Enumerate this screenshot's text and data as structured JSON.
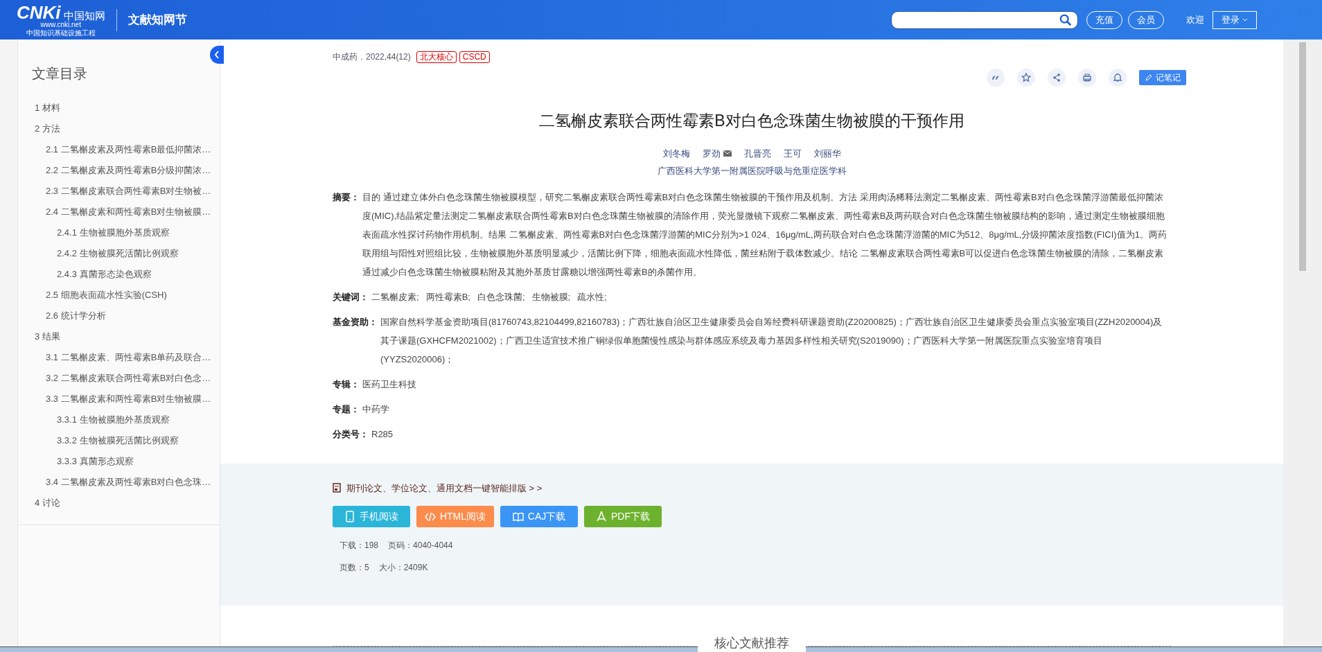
{
  "header": {
    "logo_letters": "CNKi",
    "logo_cn": "中国知网",
    "logo_url": "www.cnki.net",
    "logo_slogan": "中国知识基础设施工程",
    "section_title": "文献知网节",
    "buttons": [
      "充值",
      "会员"
    ],
    "welcome": "欢迎",
    "login": "登录"
  },
  "sidebar": {
    "title": "文章目录",
    "items": [
      {
        "label": "1 材料"
      },
      {
        "label": "2 方法",
        "children": [
          {
            "label": "2.1 二氢槲皮素及两性霉素B最低抑菌浓…"
          },
          {
            "label": "2.2 二氢槲皮素及两性霉素B分级抑菌浓…"
          },
          {
            "label": "2.3 二氢槲皮素联合两性霉素B对生物被…"
          },
          {
            "label": "2.4 二氢槲皮素和两性霉素B对生物被膜…",
            "children": [
              {
                "label": "2.4.1 生物被膜胞外基质观察"
              },
              {
                "label": "2.4.2 生物被膜死活菌比例观察"
              },
              {
                "label": "2.4.3 真菌形态染色观察"
              }
            ]
          },
          {
            "label": "2.5 细胞表面疏水性实验(CSH)"
          },
          {
            "label": "2.6 统计学分析"
          }
        ]
      },
      {
        "label": "3 结果",
        "children": [
          {
            "label": "3.1 二氢槲皮素、两性霉素B单药及联合…"
          },
          {
            "label": "3.2 二氢槲皮素联合两性霉素B对白色念…"
          },
          {
            "label": "3.3 二氢槲皮素和两性霉素B对生物被膜…",
            "children": [
              {
                "label": "3.3.1 生物被膜胞外基质观察"
              },
              {
                "label": "3.3.2 生物被膜死活菌比例观察"
              },
              {
                "label": "3.3.3 真菌形态观察"
              }
            ]
          },
          {
            "label": "3.4 二氢槲皮素及两性霉素B对白色念珠…"
          }
        ]
      },
      {
        "label": "4 讨论"
      }
    ]
  },
  "article": {
    "source": "中成药．2022,44(12)",
    "tags": [
      "北大核心",
      "CSCD"
    ],
    "note_button": "记笔记",
    "title": "二氢槲皮素联合两性霉素B对白色念珠菌生物被膜的干预作用",
    "authors": [
      {
        "name": "刘冬梅",
        "email": false
      },
      {
        "name": "罗劲",
        "email": true
      },
      {
        "name": "孔晋亮",
        "email": false
      },
      {
        "name": "王可",
        "email": false
      },
      {
        "name": "刘丽华",
        "email": false
      }
    ],
    "affiliation": "广西医科大学第一附属医院呼吸与危重症医学科",
    "fields": [
      {
        "kind": "text",
        "label": "摘要：",
        "value": "目的 通过建立体外白色念珠菌生物被膜模型，研究二氢槲皮素联合两性霉素B对白色念珠菌生物被膜的干预作用及机制。方法 采用肉汤稀释法测定二氢槲皮素、两性霉素B对白色念珠菌浮游菌最低抑菌浓度(MIC),结晶紫定量法测定二氢槲皮素联合两性霉素B对白色念珠菌生物被膜的清除作用，荧光显微镜下观察二氢槲皮素、两性霉素B及两药联合对白色念珠菌生物被膜结构的影响，通过测定生物被膜细胞表面疏水性探讨药物作用机制。结果 二氢槲皮素、两性霉素B对白色念珠菌浮游菌的MIC分别为>1 024、16μg/mL,两药联合对白色念珠菌浮游菌的MIC为512、8μg/mL,分级抑菌浓度指数(FICI)值为1。两药联用组与阳性对照组比较，生物被膜胞外基质明显减少，活菌比例下降，细胞表面疏水性降低，菌丝粘附于载体数减少。结论 二氢槲皮素联合两性霉素B可以促进白色念珠菌生物被膜的清除，二氢槲皮素通过减少白色念珠菌生物被膜粘附及其胞外基质甘露糖以增强两性霉素B的杀菌作用。"
      },
      {
        "kind": "links",
        "label": "关键词：",
        "values": [
          "二氢槲皮素;",
          "两性霉素B;",
          "白色念珠菌;",
          "生物被膜;",
          "疏水性;"
        ]
      },
      {
        "kind": "text",
        "label": "基金资助：",
        "value": "国家自然科学基金资助项目(81760743,82104499,82160783)；广西壮族自治区卫生健康委员会自筹经费科研课题资助(Z20200825)；广西壮族自治区卫生健康委员会重点实验室项目(ZZH2020004)及其子课题(GXHCFM2021002)；广西卫生适宜技术推广铜绿假单胞菌慢性感染与群体感应系统及毒力基因多样性相关研究(S2019090)；广西医科大学第一附属医院重点实验室培育项目(YYZS2020006)；"
      },
      {
        "kind": "text",
        "label": "专辑：",
        "value": "医药卫生科技"
      },
      {
        "kind": "text",
        "label": "专题：",
        "value": "中药学"
      },
      {
        "kind": "text",
        "label": "分类号：",
        "value": "R285"
      }
    ]
  },
  "downloads": {
    "promo": "期刊论文、学位论文、通用文档一键智能排版 > >",
    "buttons": [
      {
        "kind": "mobile",
        "label": "手机阅读"
      },
      {
        "kind": "html",
        "label": "HTML阅读"
      },
      {
        "kind": "caj",
        "label": "CAJ下载"
      },
      {
        "kind": "pdf",
        "label": "PDF下载"
      }
    ],
    "stats": [
      [
        "下载：198",
        "页码：4040-4044"
      ],
      [
        "页数：5",
        "大小：2409K"
      ]
    ]
  },
  "recommend": {
    "title": "核心文献推荐"
  }
}
